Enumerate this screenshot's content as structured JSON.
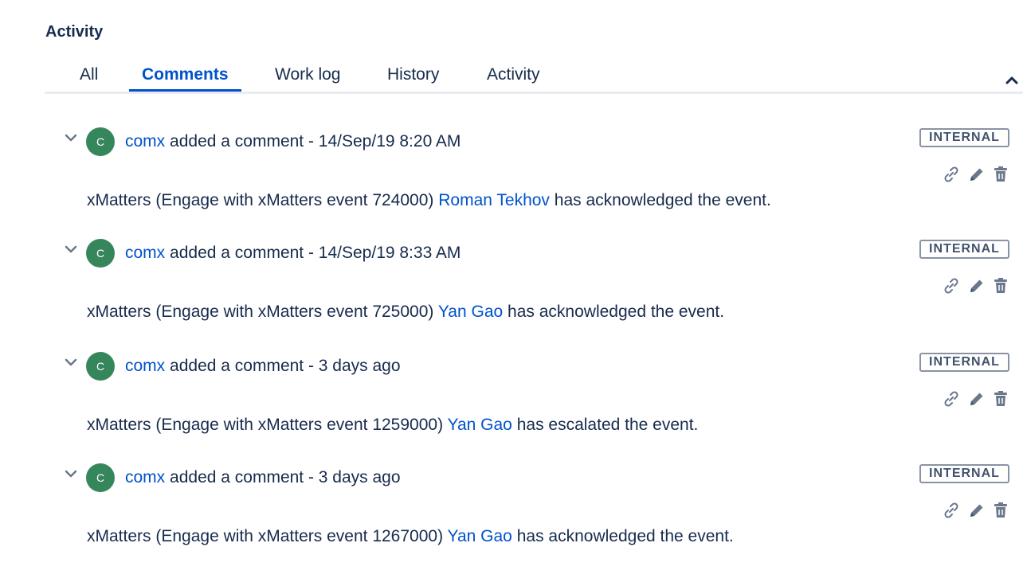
{
  "section": {
    "title": "Activity"
  },
  "tabs": [
    {
      "label": "All"
    },
    {
      "label": "Comments"
    },
    {
      "label": "Work log"
    },
    {
      "label": "History"
    },
    {
      "label": "Activity"
    }
  ],
  "active_tab": "Comments",
  "comments": [
    {
      "avatar_initial": "C",
      "author": "comx",
      "action": "added a comment - 14/Sep/19 8:20 AM",
      "badge": "INTERNAL",
      "body_prefix": "xMatters (Engage with xMatters event 724000)",
      "body_link": "Roman Tekhov",
      "body_suffix": "has acknowledged the event."
    },
    {
      "avatar_initial": "C",
      "author": "comx",
      "action": "added a comment - 14/Sep/19 8:33 AM",
      "badge": "INTERNAL",
      "body_prefix": "xMatters (Engage with xMatters event 725000)",
      "body_link": "Yan Gao",
      "body_suffix": "has acknowledged the event."
    },
    {
      "avatar_initial": "C",
      "author": "comx",
      "action": "added a comment - 3 days ago",
      "badge": "INTERNAL",
      "body_prefix": "xMatters (Engage with xMatters event 1259000)",
      "body_link": "Yan Gao",
      "body_suffix": "has escalated the event."
    },
    {
      "avatar_initial": "C",
      "author": "comx",
      "action": "added a comment - 3 days ago",
      "badge": "INTERNAL",
      "body_prefix": "xMatters (Engage with xMatters event 1267000)",
      "body_link": "Yan Gao",
      "body_suffix": "has acknowledged the event."
    }
  ],
  "colors": {
    "link": "#0052cc",
    "text": "#172b4d",
    "avatar": "#36865c",
    "badge_border": "#8993a4",
    "tab_underline": "#0052cc"
  },
  "icons": {
    "collapse": "chevron-up-icon",
    "expand": "chevron-down-icon",
    "permalink": "link-icon",
    "edit": "pencil-icon",
    "delete": "trash-icon"
  }
}
